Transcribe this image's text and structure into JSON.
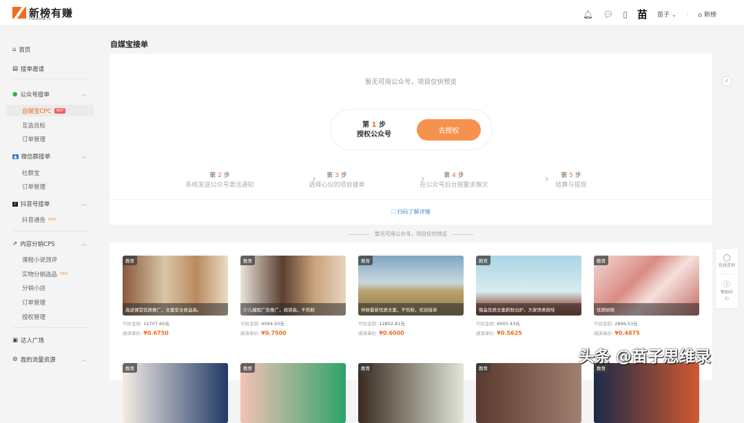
{
  "header": {
    "logo": "新榜有赚",
    "logo_sub": "X.NEWRANK.CN",
    "user": "苗子",
    "avatar_char": "苗",
    "home_link": "新榜"
  },
  "sidebar": {
    "home": "首页",
    "invite": "接单邀请",
    "wechat_group": "公众号接单",
    "wechat_items": [
      "自媒宝CPC",
      "互选竞标",
      "订单管理"
    ],
    "hot": "HOT",
    "wxgroup": "微信群接单",
    "wxgroup_items": [
      "社群宝",
      "订单管理"
    ],
    "douyin": "抖音号接单",
    "douyin_items": [
      "抖音通告"
    ],
    "new": "NEW",
    "cps": "内容分销CPS",
    "cps_items": [
      "课程小说测评",
      "实物分销选品",
      "分销小店",
      "订单管理",
      "授权管理"
    ],
    "talent": "达人广场",
    "traffic": "我的流量资源"
  },
  "page": {
    "title": "自媒宝接单",
    "notice": "暂无可用公众号，项目仅供预览",
    "step1": {
      "prefix": "第",
      "num": "1",
      "suffix": "步",
      "label": "授权公众号",
      "button": "去授权"
    },
    "steps": [
      {
        "num": "2",
        "label": "系统发送公众号激活通知"
      },
      {
        "num": "3",
        "label": "选择心仪的项目接单"
      },
      {
        "num": "4",
        "label": "在公众号后台按要求推文"
      },
      {
        "num": "5",
        "label": "结算与提现"
      }
    ],
    "step_prefix": "第",
    "step_suffix": "步",
    "scan": "扫码了解详情",
    "divider": "暂无可用公众号，项目仅供预览"
  },
  "cards": [
    {
      "tag": "教育",
      "caption": "高途课堂优质推广，文案安全收益高。",
      "amount_label": "可抢金额:",
      "amount": "11707.65元",
      "price_label": "阅读单价:",
      "price": "¥0.6750"
    },
    {
      "tag": "教育",
      "caption": "少儿编程广告推广，阅读高，不伤粉",
      "amount_label": "可抢金额:",
      "amount": "4594.50元",
      "price_label": "阅读单价:",
      "price": "¥0.7500"
    },
    {
      "tag": "教育",
      "caption": "伴财最新优质文案，不伤粉，欢迎接单",
      "amount_label": "可抢金额:",
      "amount": "12802.81元",
      "price_label": "阅读单价:",
      "price": "¥0.6000"
    },
    {
      "tag": "教育",
      "caption": "微淼优质文案新鲜出炉，大家快来抢哇",
      "amount_label": "可抢金额:",
      "amount": "6005.43元",
      "price_label": "阅读单价:",
      "price": "¥0.5625"
    },
    {
      "tag": "教育",
      "caption": "优质财商",
      "amount_label": "可抢金额:",
      "amount": "2896.53元",
      "price_label": "阅读单价:",
      "price": "¥0.4875"
    }
  ],
  "cards_row2_tags": [
    "教育",
    "教育",
    "教育",
    "教育",
    "教育"
  ],
  "float": {
    "consult": "在线咨询",
    "help": "帮助中心"
  },
  "watermark": "头条 @苗子思维录",
  "colors": {
    "accent": "#f26b1d",
    "button": "#f7924e",
    "link": "#4a90e2"
  }
}
